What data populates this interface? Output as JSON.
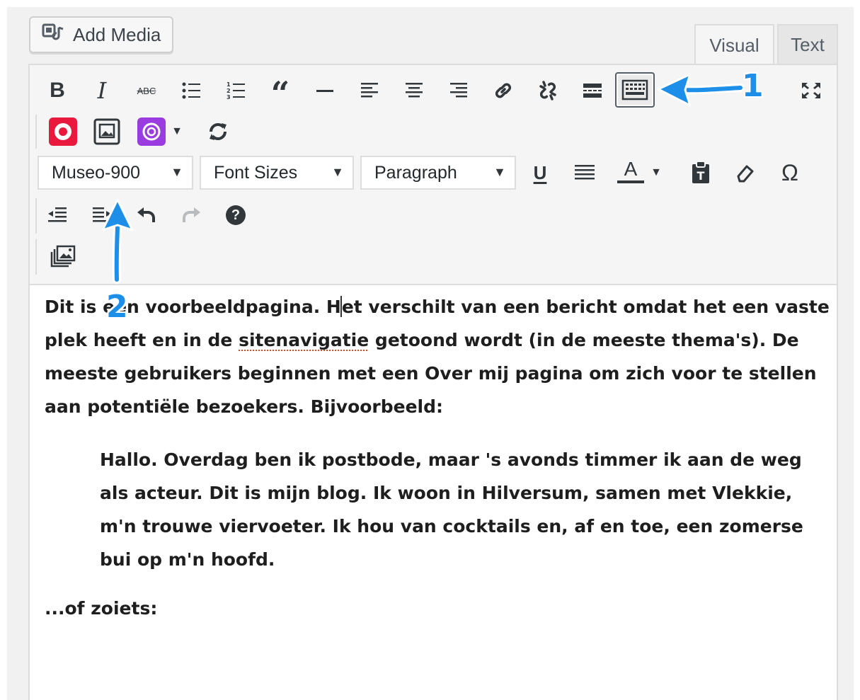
{
  "header": {
    "add_media_label": "Add Media",
    "tabs": [
      {
        "label": "Visual",
        "active": true
      },
      {
        "label": "Text",
        "active": false
      }
    ]
  },
  "toolbar": {
    "row1_icons": [
      "bold-icon",
      "italic-icon",
      "strikethrough-icon",
      "bulleted-list-icon",
      "numbered-list-icon",
      "blockquote-icon",
      "horizontal-line-icon",
      "align-left-icon",
      "align-center-icon",
      "align-right-icon",
      "insert-link-icon",
      "remove-link-icon",
      "read-more-icon",
      "toolbar-toggle-icon",
      "fullscreen-icon"
    ],
    "bold_glyph": "B",
    "italic_glyph": "I",
    "strike_glyph": "ABC",
    "quote_glyph": "“",
    "underline_glyph": "U",
    "text_color_glyph": "A",
    "omega_glyph": "Ω",
    "help_glyph": "?",
    "font_family": {
      "selected": "Museo-900"
    },
    "font_sizes": {
      "selected": "Font Sizes"
    },
    "format": {
      "selected": "Paragraph"
    },
    "dropdown_glyph": "▼",
    "active_toggle": "toolbar-toggle-icon"
  },
  "annotations": {
    "label_1": "1",
    "label_2": "2",
    "color": "#1d8fe8"
  },
  "content": {
    "p1_before_caret": "Dit is een voorbeeldpagina. H",
    "p1_after_caret": "et verschilt van een bericht omdat het een vaste plek heeft en in de ",
    "p1_misspelled": "sitenavigatie",
    "p1_end": " getoond wordt (in de meeste thema's). De meeste gebruikers beginnen met een Over mij pagina om zich voor te stellen aan potentiële bezoekers. Bijvoorbeeld:",
    "quote": "Hallo. Overdag ben ik postbode, maar 's avonds timmer ik aan de weg als acteur. Dit is mijn blog. Ik woon in Hilversum, samen met Vlekkie, m'n trouwe viervoeter. Ik hou van cocktails en, af en toe, een zomerse bui op m'n hoofd.",
    "p2": "...of zoiets:"
  }
}
